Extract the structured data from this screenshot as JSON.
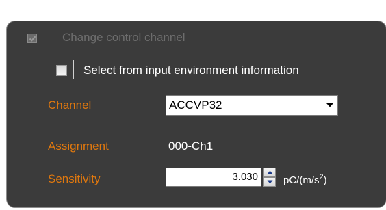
{
  "panel": {
    "change_control": {
      "label": "Change control channel",
      "checked": true,
      "enabled": false
    },
    "env_select": {
      "label": "Select from input environment information",
      "checked": false
    },
    "channel": {
      "label": "Channel",
      "value": "ACCVP32"
    },
    "assignment": {
      "label": "Assignment",
      "value": "000-Ch1"
    },
    "sensitivity": {
      "label": "Sensitivity",
      "value": "3.030",
      "unit_prefix": "pC/(m/s",
      "unit_exp": "2",
      "unit_suffix": ")"
    }
  },
  "colors": {
    "panel_bg": "#3b3b3b",
    "label_orange": "#e0780e",
    "disabled_text": "#6d6d6d",
    "value_text": "#ffffff"
  },
  "icons": {
    "header_check": "checkmark-icon",
    "dropdown": "chevron-down-icon",
    "spin_up": "triangle-up-icon",
    "spin_down": "triangle-down-icon"
  }
}
